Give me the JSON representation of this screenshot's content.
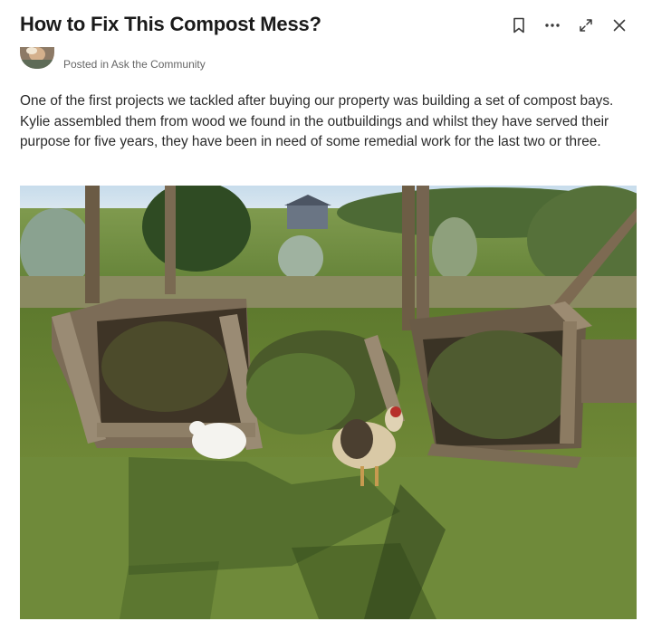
{
  "post": {
    "title": "How to Fix This Compost Mess?",
    "posted_prefix": "Posted in",
    "community": "Ask the Community",
    "body": "One of the first projects we tackled after buying our property was building a set of compost bays. Kylie assembled them from wood we found in the outbuildings and whilst they have served their purpose for five years, they have been in need of some remedial work for the last two or three."
  },
  "actions": {
    "icons": [
      "bookmark-icon",
      "more-icon",
      "expand-icon",
      "close-icon"
    ]
  },
  "colors": {
    "title": "#1a1a1a",
    "text": "#2a2a2a",
    "muted": "#666666",
    "icon": "#3a3a3a"
  }
}
